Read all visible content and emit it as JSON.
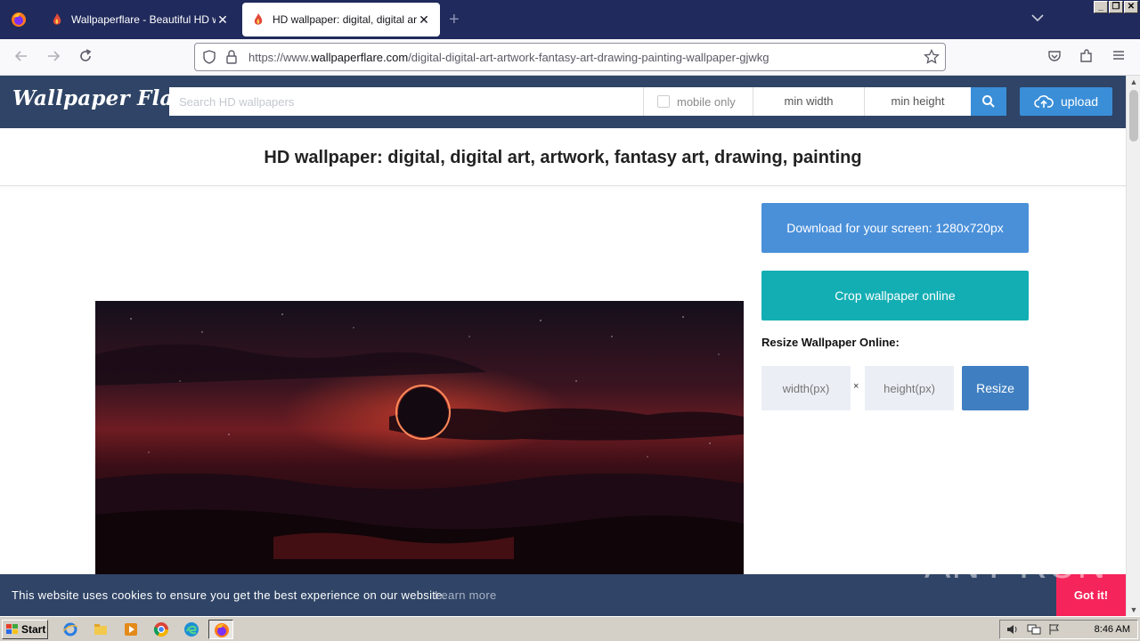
{
  "browser": {
    "tabs": [
      {
        "title": "Wallpaperflare - Beautiful HD wallpapers",
        "active": false
      },
      {
        "title": "HD wallpaper: digital, digital art, artwork",
        "active": true
      }
    ],
    "new_tab_symbol": "+",
    "url": {
      "prefix": "https://www.",
      "domain": "wallpaperflare.com",
      "path": "/digital-digital-art-artwork-fantasy-art-drawing-painting-wallpaper-gjwkg"
    }
  },
  "site": {
    "logo": "Wallpaper Flare",
    "search_placeholder": "Search HD wallpapers",
    "mobile_only": "mobile only",
    "min_width": "min width",
    "min_height": "min height",
    "upload": "upload",
    "accent": "#3a8ed8",
    "header_bg": "#2f4466"
  },
  "page": {
    "title": "HD wallpaper: digital, digital art, artwork, fantasy art, drawing, painting",
    "download_label": "Download for your screen: 1280x720px",
    "crop_label": "Crop wallpaper online",
    "resize_heading": "Resize Wallpaper Online:",
    "width_placeholder": "width(px)",
    "height_placeholder": "height(px)",
    "times_symbol": "×",
    "resize_label": "Resize"
  },
  "cookie": {
    "message": "This website uses cookies to ensure you get the best experience on our website.",
    "learn_more": "Learn more",
    "accept": "Got it!"
  },
  "taskbar": {
    "start": "Start",
    "clock": "8:46 AM"
  },
  "watermark": "ANY RUN"
}
